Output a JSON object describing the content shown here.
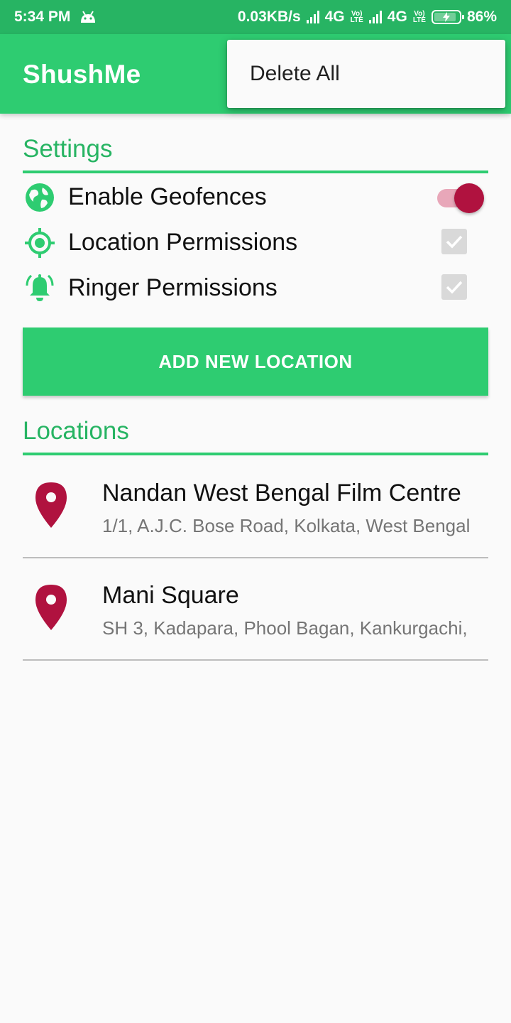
{
  "status_bar": {
    "time": "5:34 PM",
    "net_speed": "0.03KB/s",
    "net1": "4G",
    "net2": "4G",
    "volte_top": "Vo)",
    "volte_bottom": "LTE",
    "battery": "86%",
    "icons": [
      "android-icon",
      "signal-icon",
      "volte-icon",
      "battery-charging-icon"
    ]
  },
  "app_bar": {
    "title": "ShushMe"
  },
  "menu": {
    "items": [
      {
        "label": "Delete All"
      }
    ]
  },
  "settings": {
    "header": "Settings",
    "items": [
      {
        "label": "Enable Geofences",
        "icon": "globe-icon",
        "control": "switch",
        "on": true
      },
      {
        "label": "Location Permissions",
        "icon": "gps-target-icon",
        "control": "checkbox",
        "checked": true,
        "disabled": true
      },
      {
        "label": "Ringer Permissions",
        "icon": "bell-ring-icon",
        "control": "checkbox",
        "checked": true,
        "disabled": true
      }
    ]
  },
  "add_location_button": {
    "label": "ADD NEW LOCATION"
  },
  "locations": {
    "header": "Locations",
    "items": [
      {
        "name": "Nandan West Bengal Film Centre",
        "address": "1/1, A.J.C. Bose Road, Kolkata, West Bengal",
        "icon": "map-pin-icon"
      },
      {
        "name": "Mani Square",
        "address": "SH 3, Kadapara, Phool Bagan, Kankurgachi,",
        "icon": "map-pin-icon"
      }
    ]
  },
  "colors": {
    "status_bar": "#27b463",
    "primary": "#2ecc71",
    "accent": "#b0123f",
    "accent_track": "#e8a7b9",
    "text_primary": "#111111",
    "text_secondary": "#757575"
  }
}
